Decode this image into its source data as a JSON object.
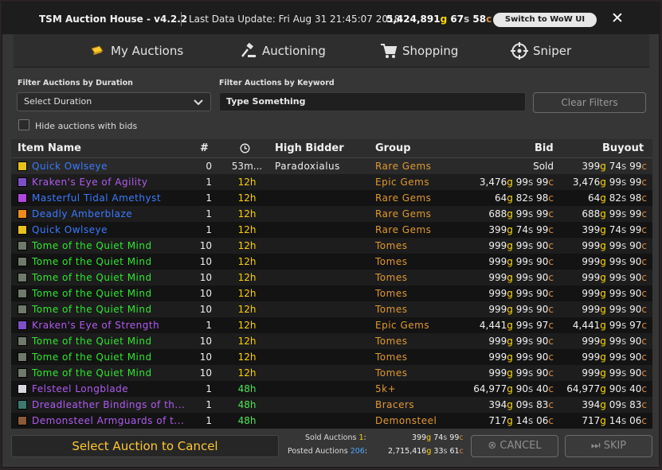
{
  "titlebar": {
    "title": "TSM Auction House - v4.2.2",
    "last_update": "Last Data Update: Fri Aug 31 21:45:07 2018",
    "gold": "5,424,891",
    "silver": "67",
    "copper": "58",
    "switch_label": "Switch to WoW UI",
    "close_glyph": "✕"
  },
  "tabs": [
    {
      "label": "My Auctions",
      "icon": "auction-icon",
      "active": true
    },
    {
      "label": "Auctioning",
      "icon": "gavel-icon",
      "active": false
    },
    {
      "label": "Shopping",
      "icon": "cart-icon",
      "active": false
    },
    {
      "label": "Sniper",
      "icon": "crosshair-icon",
      "active": false
    }
  ],
  "filters": {
    "duration_label": "Filter Auctions by Duration",
    "duration_value": "Select Duration",
    "keyword_label": "Filter Auctions by Keyword",
    "keyword_placeholder": "Type Something",
    "clear_label": "Clear Filters",
    "hide_bids_label": "Hide auctions with bids"
  },
  "table": {
    "headers": {
      "name": "Item Name",
      "qty": "#",
      "time_icon": "clock-icon",
      "bidder": "High Bidder",
      "group": "Group",
      "bid": "Bid",
      "buyout": "Buyout"
    },
    "rows": [
      {
        "name": "Quick Owlseye",
        "quality": "rare",
        "icon_color": "#e6c21a",
        "qty": "0",
        "time": "53m...",
        "bidder": "Paradoxialus",
        "group": "Rare Gems",
        "bid_sold": "Sold",
        "buyout": [
          "399",
          "74",
          "99"
        ]
      },
      {
        "name": "Kraken's Eye of Agility",
        "quality": "epic",
        "icon_color": "#7f4fc8",
        "qty": "1",
        "time": "12h",
        "bidder": "",
        "group": "Epic Gems",
        "bid": [
          "3,476",
          "99",
          "99"
        ],
        "buyout": [
          "3,476",
          "99",
          "99"
        ]
      },
      {
        "name": "Masterful Tidal Amethyst",
        "quality": "rare",
        "icon_color": "#b046e0",
        "qty": "1",
        "time": "12h",
        "bidder": "",
        "group": "Rare Gems",
        "bid": [
          "64",
          "82",
          "98"
        ],
        "buyout": [
          "64",
          "82",
          "98"
        ]
      },
      {
        "name": "Deadly Amberblaze",
        "quality": "rare",
        "icon_color": "#f08a1c",
        "qty": "1",
        "time": "12h",
        "bidder": "",
        "group": "Rare Gems",
        "bid": [
          "688",
          "99",
          "99"
        ],
        "buyout": [
          "688",
          "99",
          "99"
        ]
      },
      {
        "name": "Quick Owlseye",
        "quality": "rare",
        "icon_color": "#e6c21a",
        "qty": "1",
        "time": "12h",
        "bidder": "",
        "group": "Rare Gems",
        "bid": [
          "399",
          "74",
          "99"
        ],
        "buyout": [
          "399",
          "74",
          "99"
        ]
      },
      {
        "name": "Tome of the Quiet Mind",
        "quality": "uncommon",
        "icon_color": "#6e7a6a",
        "qty": "10",
        "time": "12h",
        "bidder": "",
        "group": "Tomes",
        "bid": [
          "999",
          "99",
          "90"
        ],
        "buyout": [
          "999",
          "99",
          "90"
        ]
      },
      {
        "name": "Tome of the Quiet Mind",
        "quality": "uncommon",
        "icon_color": "#6e7a6a",
        "qty": "10",
        "time": "12h",
        "bidder": "",
        "group": "Tomes",
        "bid": [
          "999",
          "99",
          "90"
        ],
        "buyout": [
          "999",
          "99",
          "90"
        ]
      },
      {
        "name": "Tome of the Quiet Mind",
        "quality": "uncommon",
        "icon_color": "#6e7a6a",
        "qty": "10",
        "time": "12h",
        "bidder": "",
        "group": "Tomes",
        "bid": [
          "999",
          "99",
          "90"
        ],
        "buyout": [
          "999",
          "99",
          "90"
        ]
      },
      {
        "name": "Tome of the Quiet Mind",
        "quality": "uncommon",
        "icon_color": "#6e7a6a",
        "qty": "10",
        "time": "12h",
        "bidder": "",
        "group": "Tomes",
        "bid": [
          "999",
          "99",
          "90"
        ],
        "buyout": [
          "999",
          "99",
          "90"
        ]
      },
      {
        "name": "Tome of the Quiet Mind",
        "quality": "uncommon",
        "icon_color": "#6e7a6a",
        "qty": "10",
        "time": "12h",
        "bidder": "",
        "group": "Tomes",
        "bid": [
          "999",
          "99",
          "90"
        ],
        "buyout": [
          "999",
          "99",
          "90"
        ]
      },
      {
        "name": "Kraken's Eye of Strength",
        "quality": "epic",
        "icon_color": "#7f4fc8",
        "qty": "1",
        "time": "12h",
        "bidder": "",
        "group": "Epic Gems",
        "bid": [
          "4,441",
          "99",
          "97"
        ],
        "buyout": [
          "4,441",
          "99",
          "97"
        ]
      },
      {
        "name": "Tome of the Quiet Mind",
        "quality": "uncommon",
        "icon_color": "#6e7a6a",
        "qty": "10",
        "time": "12h",
        "bidder": "",
        "group": "Tomes",
        "bid": [
          "999",
          "99",
          "90"
        ],
        "buyout": [
          "999",
          "99",
          "90"
        ]
      },
      {
        "name": "Tome of the Quiet Mind",
        "quality": "uncommon",
        "icon_color": "#6e7a6a",
        "qty": "10",
        "time": "12h",
        "bidder": "",
        "group": "Tomes",
        "bid": [
          "999",
          "99",
          "90"
        ],
        "buyout": [
          "999",
          "99",
          "90"
        ]
      },
      {
        "name": "Tome of the Quiet Mind",
        "quality": "uncommon",
        "icon_color": "#6e7a6a",
        "qty": "10",
        "time": "12h",
        "bidder": "",
        "group": "Tomes",
        "bid": [
          "999",
          "99",
          "90"
        ],
        "buyout": [
          "999",
          "99",
          "90"
        ]
      },
      {
        "name": "Felsteel Longblade",
        "quality": "epic",
        "icon_color": "#d8d8e0",
        "qty": "1",
        "time": "48h",
        "bidder": "",
        "group": "5k+",
        "bid": [
          "64,977",
          "90",
          "40"
        ],
        "buyout": [
          "64,977",
          "90",
          "40"
        ]
      },
      {
        "name": "Dreadleather Bindings of th...",
        "quality": "epic",
        "icon_color": "#3c7a70",
        "qty": "1",
        "time": "48h",
        "bidder": "",
        "group": "Bracers",
        "bid": [
          "394",
          "09",
          "83"
        ],
        "buyout": [
          "394",
          "09",
          "83"
        ]
      },
      {
        "name": "Demonsteel Armguards of t...",
        "quality": "epic",
        "icon_color": "#8a5a3a",
        "qty": "1",
        "time": "48h",
        "bidder": "",
        "group": "Demonsteel",
        "bid": [
          "717",
          "14",
          "06"
        ],
        "buyout": [
          "717",
          "14",
          "06"
        ]
      }
    ]
  },
  "footer": {
    "cancel_select_label": "Select Auction to Cancel",
    "sold_label": "Sold Auctions",
    "sold_count": "1",
    "sold_value": [
      "399",
      "74",
      "99"
    ],
    "posted_label": "Posted Auctions",
    "posted_count": "206",
    "posted_value": [
      "2,715,416",
      "33",
      "61"
    ],
    "cancel_label": "CANCEL",
    "skip_label": "SKIP"
  },
  "colors": {
    "accent": "#ffc930",
    "gold": "#ffd700",
    "silver": "#c8c8c8",
    "copper": "#e08a3e",
    "quality_rare": "#3a7bff",
    "quality_epic": "#b05cf0",
    "quality_uncommon": "#2ee62e",
    "group": "#e09830",
    "time_12h": "#ffd000",
    "time_48h": "#4fe64f",
    "count_blue": "#4aa8ff"
  }
}
